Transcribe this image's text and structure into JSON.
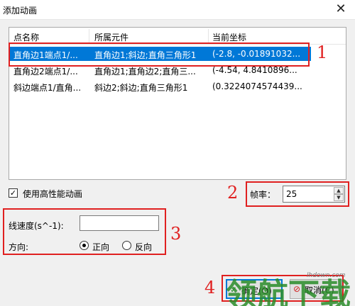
{
  "window": {
    "title": "添加动画",
    "close_glyph": "✕"
  },
  "list": {
    "columns": [
      "点名称",
      "所属元件",
      "当前坐标"
    ],
    "rows": [
      {
        "name": "直角边1端点1/...",
        "owner": "直角边1;斜边;直角三角形1",
        "coord": "(-2.8, -0.01891032...",
        "selected": true
      },
      {
        "name": "直角边2端点1/...",
        "owner": "直角边1;直角边2;直角三...",
        "coord": "(-4.54, 4.8410896..."
      },
      {
        "name": "斜边端点1/直角...",
        "owner": "斜边2;斜边;直角三角形1",
        "coord": "(0.3224074574439..."
      }
    ]
  },
  "options": {
    "high_perf_label": "使用高性能动画",
    "high_perf_checked": true,
    "fps_label": "帧率：",
    "fps_value": "25"
  },
  "motion": {
    "speed_label": "线速度(s^-1):",
    "speed_value": "",
    "direction_label": "方向:",
    "forward_label": "正向",
    "reverse_label": "反向",
    "selected_direction": "forward"
  },
  "buttons": {
    "ok": "确定(O)",
    "cancel": "取消(C)"
  },
  "annotations": [
    "1",
    "2",
    "3",
    "4"
  ],
  "watermark": {
    "text": "领航下载",
    "site": "lhdown.com"
  },
  "colors": {
    "selection": "#0078d7",
    "annotation": "#e02020",
    "watermark": "#2a8d2a"
  }
}
